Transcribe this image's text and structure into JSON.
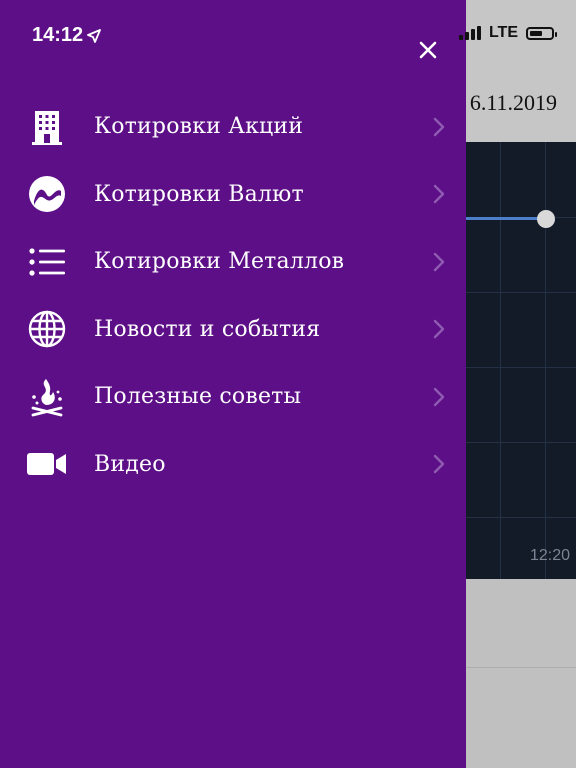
{
  "status_bar": {
    "time": "14:12",
    "network": "LTE"
  },
  "background": {
    "date_fragment": "6.11.2019",
    "chart_time": "12:20"
  },
  "drawer": {
    "close_label": "×",
    "items": [
      {
        "label": "Котировки Акций",
        "icon": "building-icon"
      },
      {
        "label": "Котировки Валют",
        "icon": "currency-wave-icon"
      },
      {
        "label": "Котировки Металлов",
        "icon": "list-icon"
      },
      {
        "label": "Новости и события",
        "icon": "globe-icon"
      },
      {
        "label": "Полезные советы",
        "icon": "campfire-icon"
      },
      {
        "label": "Видео",
        "icon": "video-camera-icon"
      }
    ]
  },
  "colors": {
    "drawer_bg": "#5d0f87",
    "chart_bg": "#141b28",
    "chart_line": "#4d7ec9"
  }
}
